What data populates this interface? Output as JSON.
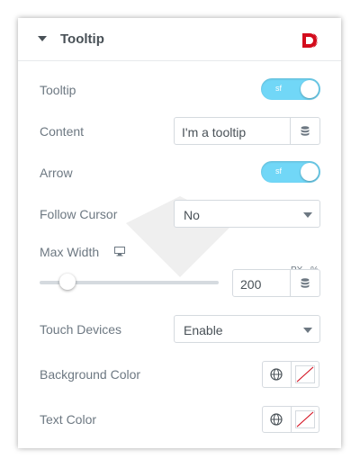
{
  "header": {
    "title": "Tooltip"
  },
  "rows": {
    "tooltip": {
      "label": "Tooltip",
      "toggle_text": "ꟷ"
    },
    "content": {
      "label": "Content",
      "value": "I'm a tooltip"
    },
    "arrow": {
      "label": "Arrow",
      "toggle_text": "ꟷ"
    },
    "follow_cursor": {
      "label": "Follow Cursor",
      "value": "No"
    },
    "max_width": {
      "label": "Max Width",
      "unit_px": "PX",
      "unit_pct": "%",
      "value": "200",
      "slider_fraction": 0.14
    },
    "touch_devices": {
      "label": "Touch Devices",
      "value": "Enable"
    },
    "background_color": {
      "label": "Background Color"
    },
    "text_color": {
      "label": "Text Color"
    }
  },
  "colors": {
    "accent": "#71d7f7",
    "brand": "#d30c1c",
    "text": "#6d7882"
  }
}
